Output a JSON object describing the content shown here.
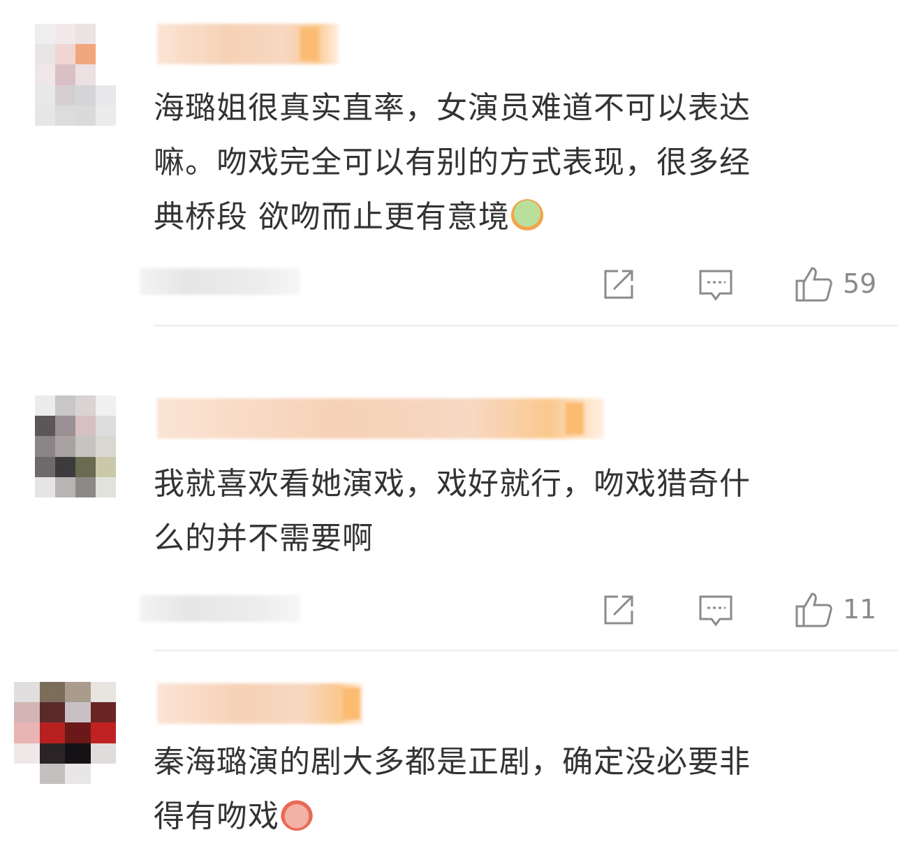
{
  "comments": [
    {
      "text": "海璐姐很真实直率，女演员难道不可以表达嘛。吻戏完全可以有别的方式表现，很多经典桥段 欲吻而止更有意境",
      "lines": [
        "海璐姐很真实直率，女演员难道不可以表达",
        "嘛。吻戏完全可以有别的方式表现，很多经",
        "典桥段 欲吻而止更有意境"
      ],
      "emoji": "green-cactus-emoji",
      "likes": "59"
    },
    {
      "text": "我就喜欢看她演戏，戏好就行，吻戏猎奇什么的并不需要啊",
      "lines": [
        "我就喜欢看她演戏，戏好就行，吻戏猎奇什",
        "么的并不需要啊"
      ],
      "likes": "11"
    },
    {
      "text": "秦海璐演的剧大多都是正剧，确定没必要非得有吻戏",
      "lines": [
        "秦海璐演的剧大多都是正剧，确定没必要非",
        "得有吻戏"
      ],
      "emoji": "angry-face-emoji"
    }
  ],
  "icons": {
    "share": "share-icon",
    "reply": "comment-icon",
    "like": "thumbs-up-icon"
  },
  "colors": {
    "text": "#333333",
    "icon": "#8a8a8a",
    "divider": "#ececec",
    "username_blur": "#f6cfb2"
  }
}
